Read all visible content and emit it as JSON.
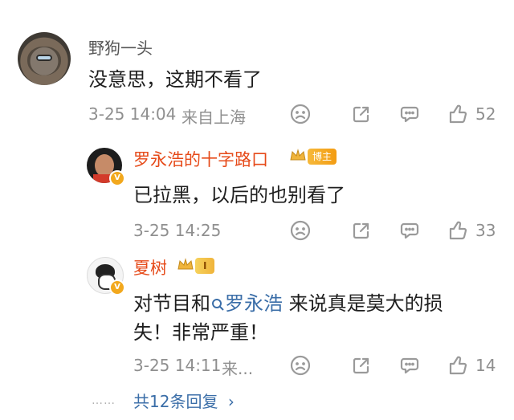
{
  "comment": {
    "username": "野狗一头",
    "text": "没意思，这期不看了",
    "timestamp": "3-25 14:04",
    "location": "来自上海",
    "like_count": "52"
  },
  "replies": [
    {
      "username": "罗永浩的十字路口",
      "badge_text": "博主",
      "text": "已拉黑，以后的也别看了",
      "timestamp": "3-25 14:25",
      "like_count": "33"
    },
    {
      "username": "夏树",
      "badge_text": "I",
      "text_before": "对节目和",
      "mention": "罗永浩",
      "text_after": " 来说真是莫大的损",
      "text_line2": "失！非常严重！",
      "timestamp": "3-25 14:11",
      "timestamp_suffix": "来...",
      "like_count": "14"
    }
  ],
  "more_replies": {
    "dots": "……",
    "label": "共12条回复",
    "chevron": "›"
  },
  "icons": {
    "dislike": "sad-face-icon",
    "share": "share-icon",
    "comment": "comment-icon",
    "like": "thumb-up-icon",
    "verified": "v-badge-icon",
    "crown": "crown-icon",
    "search": "search-icon"
  },
  "colors": {
    "link_blue": "#3b6ea8",
    "reply_name": "#e64a19",
    "meta_gray": "#8f8f8f"
  }
}
